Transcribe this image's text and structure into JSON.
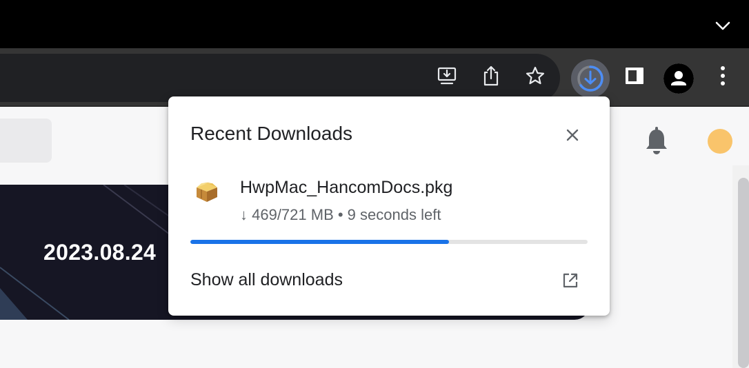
{
  "toolbar": {
    "icons": [
      "install-app-icon",
      "share-icon",
      "bookmark-star-icon",
      "downloads-icon",
      "side-panel-icon",
      "profile-icon",
      "more-menu-icon"
    ],
    "download_progress": 0.6505
  },
  "page": {
    "banner_date": "2023.08.24",
    "avatar_color": "#f9c46b"
  },
  "downloads_bubble": {
    "title": "Recent Downloads",
    "item": {
      "file_name": "HwpMac_HancomDocs.pkg",
      "status": "↓ 469/721 MB • 9 seconds left",
      "progress": 0.6505,
      "progress_color": "#1a73e8"
    },
    "show_all_label": "Show all downloads"
  }
}
